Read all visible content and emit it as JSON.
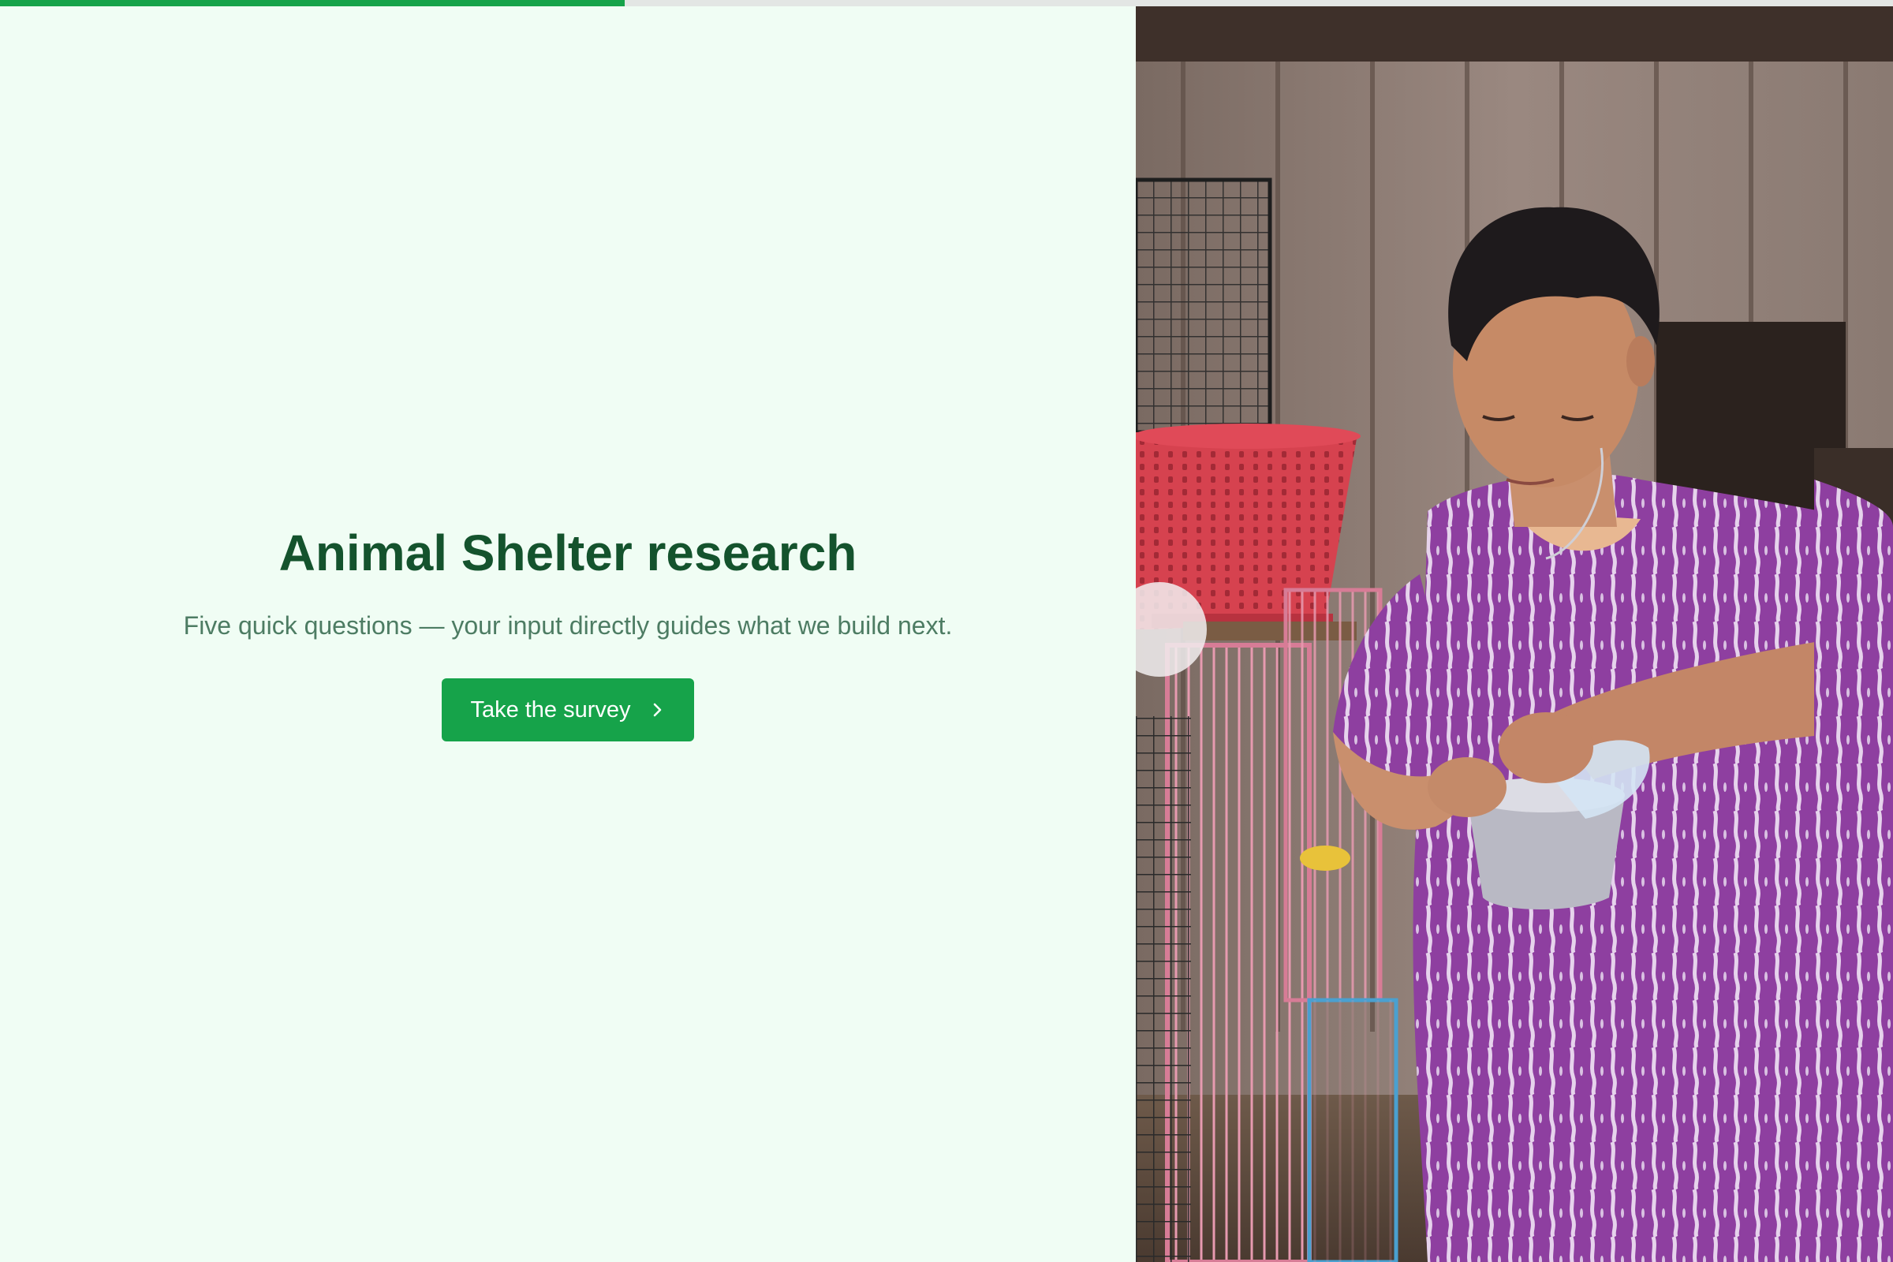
{
  "progress": {
    "fraction": 0.33
  },
  "hero": {
    "title": "Animal Shelter research",
    "subtitle": "Five quick questions — your input directly guides what we build next.",
    "cta_label": "Take the survey",
    "cta_icon": "chevron-right-icon"
  },
  "colors": {
    "accent": "#16a34a",
    "title": "#14532d",
    "subtitle": "#4d7c63",
    "background": "#f0fdf4"
  },
  "photo": {
    "subject": "shelter-worker-photo"
  }
}
